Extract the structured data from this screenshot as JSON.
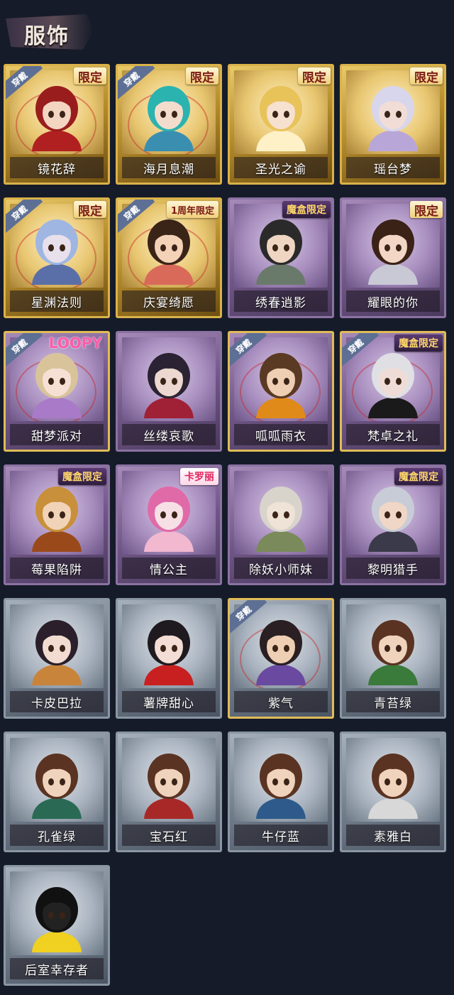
{
  "header": {
    "title": "服饰"
  },
  "cards": [
    {
      "name": "镜花辞",
      "tier": "gold",
      "worn": true,
      "badge": "限定",
      "badge_style": "normal",
      "hair": "#9a1d1d",
      "skin": "#f3d5c2",
      "outfit": "#b02020",
      "icon": "red-hood-portrait-icon"
    },
    {
      "name": "海月息潮",
      "tier": "gold",
      "worn": true,
      "badge": "限定",
      "badge_style": "normal",
      "hair": "#2bb3b0",
      "skin": "#f4dccd",
      "outfit": "#3a8fb0",
      "icon": "ocean-princess-portrait-icon"
    },
    {
      "name": "圣光之谕",
      "tier": "gold",
      "worn": false,
      "badge": "限定",
      "badge_style": "normal",
      "hair": "#e8c35a",
      "skin": "#f6e0cf",
      "outfit": "#fff1c7",
      "icon": "holy-light-portrait-icon"
    },
    {
      "name": "瑶台梦",
      "tier": "gold",
      "worn": false,
      "badge": "限定",
      "badge_style": "normal",
      "hair": "#d8d6ec",
      "skin": "#f1ddd6",
      "outfit": "#b9a6d8",
      "icon": "dream-palace-portrait-icon"
    },
    {
      "name": "星渊法则",
      "tier": "gold",
      "worn": true,
      "badge": "限定",
      "badge_style": "normal",
      "hair": "#9fb6e2",
      "skin": "#e8e0ea",
      "outfit": "#5a6fa8",
      "icon": "star-abyss-portrait-icon"
    },
    {
      "name": "庆宴绮愿",
      "tier": "gold",
      "worn": true,
      "badge": "1周年限定",
      "badge_style": "anniv",
      "hair": "#3a2418",
      "skin": "#f3d2b8",
      "outfit": "#d96a5a",
      "icon": "banquet-portrait-icon"
    },
    {
      "name": "绣春逍影",
      "tier": "purple",
      "worn": false,
      "badge": "魔盒限定",
      "badge_style": "box",
      "hair": "#2a2a2a",
      "skin": "#efd6c2",
      "outfit": "#6a7a6a",
      "icon": "embroidered-portrait-icon"
    },
    {
      "name": "耀眼的你",
      "tier": "purple",
      "worn": false,
      "badge": "限定",
      "badge_style": "normal",
      "hair": "#3a2216",
      "skin": "#f3d6c6",
      "outfit": "#c9c9d6",
      "icon": "cowboy-hat-portrait-icon"
    },
    {
      "name": "甜梦派对",
      "tier": "purple",
      "worn": true,
      "badge": "LOOPY",
      "badge_style": "loopy",
      "hair": "#d9c39a",
      "skin": "#f6e0d4",
      "outfit": "#a97ac8",
      "icon": "sweet-dream-portrait-icon"
    },
    {
      "name": "丝缕哀歌",
      "tier": "purple",
      "worn": false,
      "badge": "",
      "badge_style": "none",
      "hair": "#2b2233",
      "skin": "#ecd8d0",
      "outfit": "#a02035",
      "icon": "lace-elegy-portrait-icon"
    },
    {
      "name": "呱呱雨衣",
      "tier": "purple",
      "worn": true,
      "badge": "",
      "badge_style": "none",
      "hair": "#5a3a22",
      "skin": "#efcfb4",
      "outfit": "#e08a1a",
      "icon": "frog-raincoat-portrait-icon"
    },
    {
      "name": "梵卓之礼",
      "tier": "purple",
      "worn": true,
      "badge": "魔盒限定",
      "badge_style": "box",
      "hair": "#e0e0e4",
      "skin": "#f0dcd6",
      "outfit": "#1a1a1a",
      "icon": "ventrue-portrait-icon"
    },
    {
      "name": "莓果陷阱",
      "tier": "purple",
      "worn": false,
      "badge": "魔盒限定",
      "badge_style": "box",
      "hair": "#c8903a",
      "skin": "#f1d3b8",
      "outfit": "#9a4a1a",
      "icon": "berry-trap-portrait-icon"
    },
    {
      "name": "情公主",
      "tier": "purple",
      "worn": false,
      "badge": "卡罗丽",
      "badge_style": "pink",
      "hair": "#e06aa8",
      "skin": "#f6e0e6",
      "outfit": "#f2b8d0",
      "icon": "love-princess-portrait-icon"
    },
    {
      "name": "除妖小师妹",
      "tier": "purple",
      "worn": false,
      "badge": "",
      "badge_style": "none",
      "hair": "#d8d4cc",
      "skin": "#efe2d6",
      "outfit": "#7a8a5a",
      "icon": "demon-hunter-portrait-icon"
    },
    {
      "name": "黎明猎手",
      "tier": "purple",
      "worn": false,
      "badge": "魔盒限定",
      "badge_style": "box",
      "hair": "#c8ccd6",
      "skin": "#f0d6c6",
      "outfit": "#3a3a4a",
      "icon": "dawn-hunter-portrait-icon"
    },
    {
      "name": "卡皮巴拉",
      "tier": "gray",
      "worn": false,
      "badge": "",
      "badge_style": "none",
      "hair": "#2a1f2a",
      "skin": "#f2dcd2",
      "outfit": "#c8843a",
      "icon": "capybara-hood-portrait-icon"
    },
    {
      "name": "薯牌甜心",
      "tier": "gray",
      "worn": false,
      "badge": "",
      "badge_style": "none",
      "hair": "#1f1a1f",
      "skin": "#f4ddd4",
      "outfit": "#c82020",
      "icon": "fries-sweetheart-portrait-icon"
    },
    {
      "name": "紫气",
      "tier": "gray",
      "worn": true,
      "badge": "",
      "badge_style": "none",
      "hair": "#2a1f22",
      "skin": "#efcfb4",
      "outfit": "#6a4aa0",
      "icon": "purple-aura-portrait-icon"
    },
    {
      "name": "青苔绿",
      "tier": "gray",
      "worn": false,
      "badge": "",
      "badge_style": "none",
      "hair": "#5a3322",
      "skin": "#f0d3bc",
      "outfit": "#3a7a3a",
      "icon": "moss-green-portrait-icon"
    },
    {
      "name": "孔雀绿",
      "tier": "gray",
      "worn": false,
      "badge": "",
      "badge_style": "none",
      "hair": "#5a3322",
      "skin": "#f0d3bc",
      "outfit": "#2a6a55",
      "icon": "peacock-green-portrait-icon"
    },
    {
      "name": "宝石红",
      "tier": "gray",
      "worn": false,
      "badge": "",
      "badge_style": "none",
      "hair": "#5a3322",
      "skin": "#f0d3bc",
      "outfit": "#a82828",
      "icon": "ruby-red-portrait-icon"
    },
    {
      "name": "牛仔蓝",
      "tier": "gray",
      "worn": false,
      "badge": "",
      "badge_style": "none",
      "hair": "#5a3322",
      "skin": "#f0d3bc",
      "outfit": "#2d5a8a",
      "icon": "denim-blue-portrait-icon"
    },
    {
      "name": "素雅白",
      "tier": "gray",
      "worn": false,
      "badge": "",
      "badge_style": "none",
      "hair": "#5a3322",
      "skin": "#f0d3bc",
      "outfit": "#d8d8d8",
      "icon": "elegant-white-portrait-icon"
    },
    {
      "name": "后室幸存者",
      "tier": "gray",
      "worn": false,
      "badge": "",
      "badge_style": "none",
      "hair": "#111111",
      "skin": "#222222",
      "outfit": "#f0d020",
      "icon": "gas-mask-survivor-portrait-icon"
    }
  ],
  "labels": {
    "worn": "穿戴"
  }
}
